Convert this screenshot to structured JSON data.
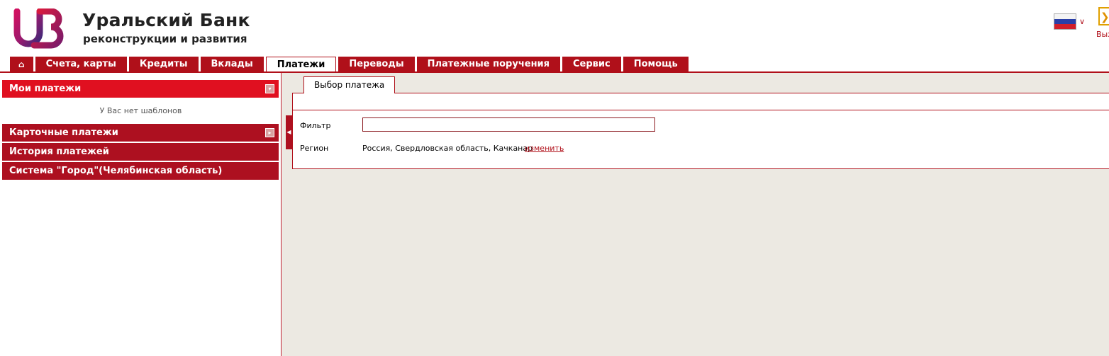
{
  "header": {
    "bank_name": "Уральский Банк",
    "bank_sub": "реконструкции и развития",
    "exit_label": "Вых"
  },
  "nav": {
    "home_icon": "home-icon",
    "tabs": [
      {
        "label": "Счета, карты"
      },
      {
        "label": "Кредиты"
      },
      {
        "label": "Вклады"
      },
      {
        "label": "Платежи",
        "active": true
      },
      {
        "label": "Переводы"
      },
      {
        "label": "Платежные поручения"
      },
      {
        "label": "Сервис"
      },
      {
        "label": "Помощь"
      }
    ]
  },
  "sidebar": {
    "my_payments": "Мои платежи",
    "no_templates": "У Вас нет шаблонов",
    "card_payments": "Карточные платежи",
    "history": "История платежей",
    "system_gorod": "Система \"Город\"(Челябинская область)"
  },
  "main": {
    "tab_label": "Выбор платежа",
    "filter_label": "Фильтр",
    "filter_value": "",
    "region_label": "Регион",
    "region_value": "Россия, Свердловская область, Качканар",
    "region_change": "изменить"
  },
  "colors": {
    "brand_red": "#b0101a",
    "active_red": "#e01020",
    "background_gray": "#ece9e2"
  }
}
